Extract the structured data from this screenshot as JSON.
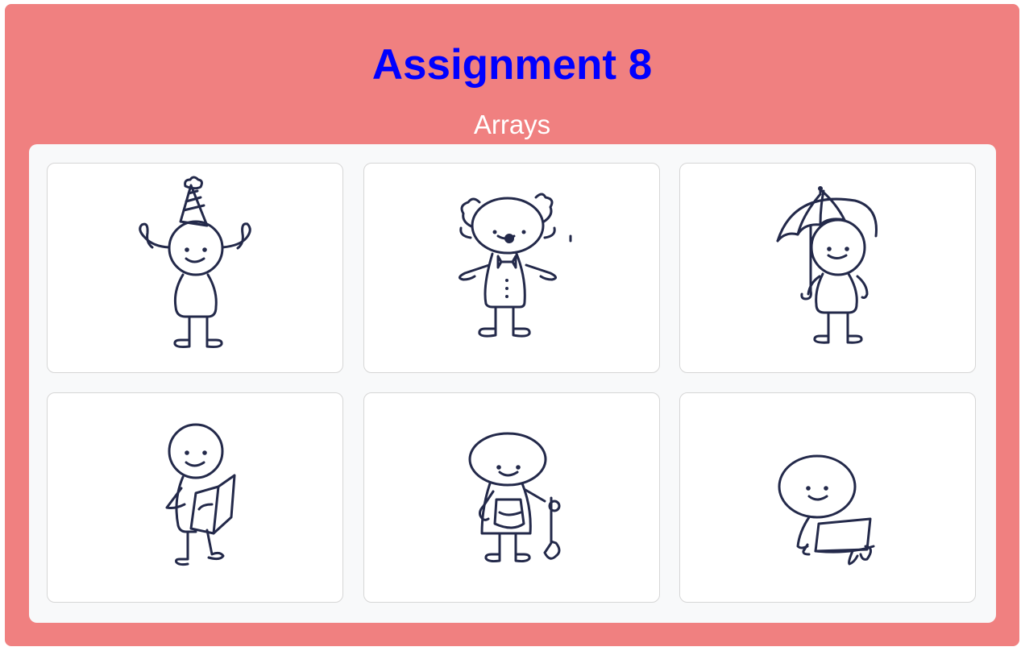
{
  "page": {
    "title": "Assignment 8",
    "subtitle": "Arrays"
  },
  "colors": {
    "background": "#f08080",
    "title": "#0000ff",
    "subtitle": "#ffffff",
    "gallery": "#f8f9fa",
    "card": "#ffffff",
    "ink": "#23294a"
  },
  "gallery": {
    "items": [
      {
        "icon": "stick-figure-party-hat-icon"
      },
      {
        "icon": "stick-figure-clown-icon"
      },
      {
        "icon": "stick-figure-umbrella-icon"
      },
      {
        "icon": "stick-figure-reading-book-icon"
      },
      {
        "icon": "stick-figure-gardener-shovel-icon"
      },
      {
        "icon": "stick-figure-laptop-icon"
      }
    ]
  }
}
